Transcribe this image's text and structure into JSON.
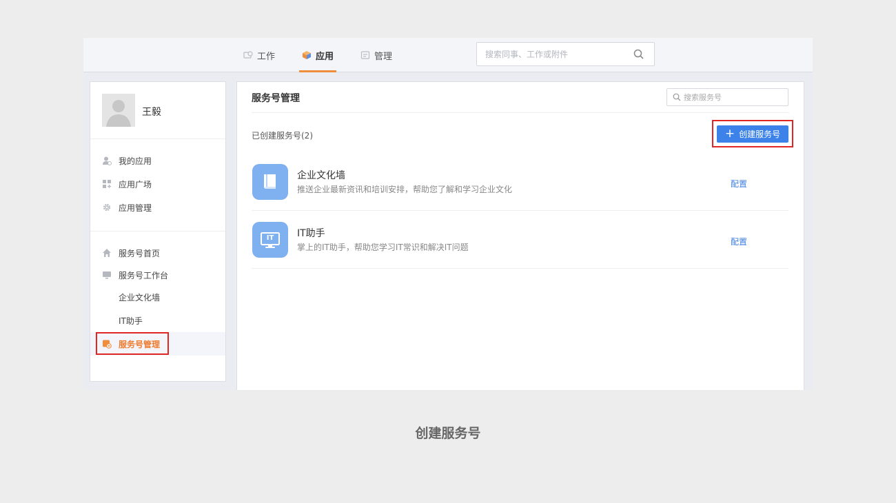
{
  "topnav": {
    "tabs": [
      {
        "label": "工作",
        "icon": "work-icon"
      },
      {
        "label": "应用",
        "icon": "cube-icon",
        "active": true
      },
      {
        "label": "管理",
        "icon": "manage-icon"
      }
    ],
    "search_placeholder": "搜索同事、工作或附件"
  },
  "sidebar": {
    "user_name": "王毅",
    "group1": [
      {
        "label": "我的应用",
        "icon": "user-app-icon"
      },
      {
        "label": "应用广场",
        "icon": "grid-icon"
      },
      {
        "label": "应用管理",
        "icon": "gear-icon"
      }
    ],
    "group2": [
      {
        "label": "服务号首页",
        "icon": "home-icon"
      },
      {
        "label": "服务号工作台",
        "icon": "monitor-icon"
      },
      {
        "label": "企业文化墙",
        "sub": true
      },
      {
        "label": "IT助手",
        "sub": true
      },
      {
        "label": "服务号管理",
        "icon": "service-manage-icon",
        "active": true
      }
    ]
  },
  "main": {
    "title": "服务号管理",
    "search_placeholder": "搜索服务号",
    "created_label": "已创建服务号(2)",
    "create_button": "创建服务号",
    "services": [
      {
        "name": "企业文化墙",
        "desc": "推送企业最新资讯和培训安排，帮助您了解和学习企业文化",
        "config": "配置",
        "icon": "book-icon"
      },
      {
        "name": "IT助手",
        "desc": "掌上的IT助手，帮助您学习IT常识和解决IT问题",
        "config": "配置",
        "icon": "it-monitor-icon",
        "icon_text": "IT"
      }
    ]
  },
  "caption": "创建服务号",
  "colors": {
    "accent": "#f08d3c",
    "primary": "#3c82e8",
    "highlight": "#e02525",
    "icon_bg": "#7fb0ef"
  }
}
